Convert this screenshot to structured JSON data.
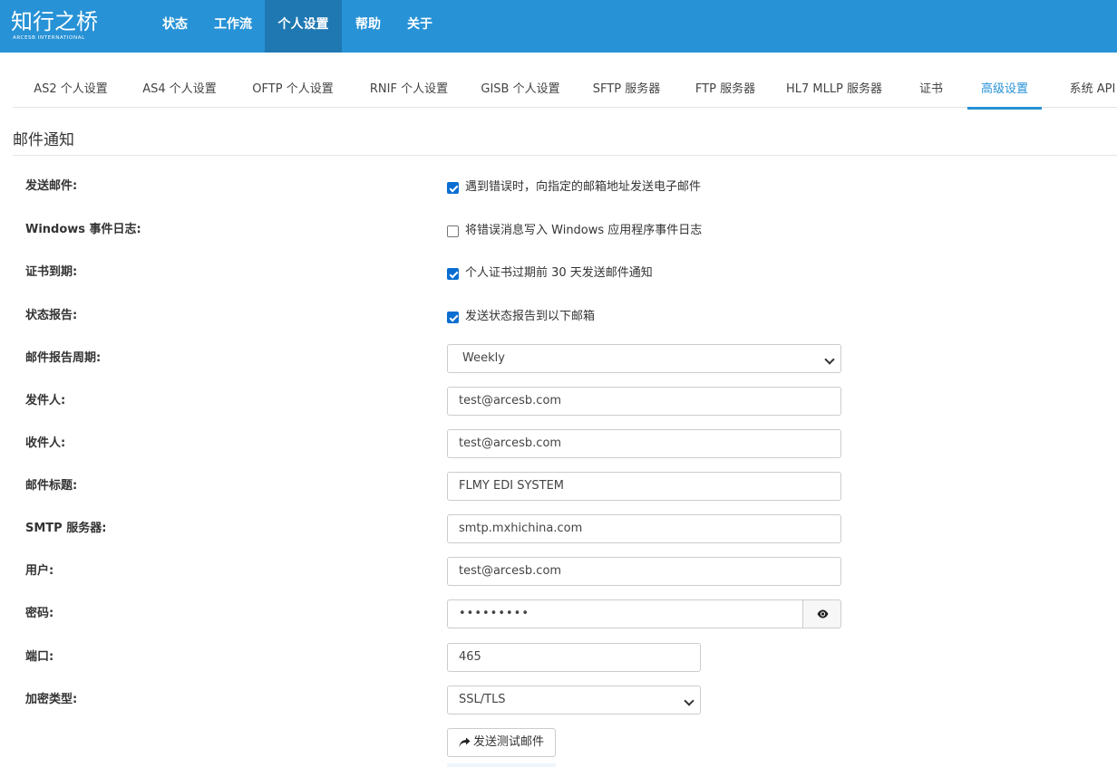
{
  "brand": {
    "name": "知行之桥",
    "tagline": "ARCESB INTERNATIONAL"
  },
  "colors": {
    "navbar": "#2792d6",
    "navbar_active": "#1f78b2",
    "accent": "#2792d6",
    "checkbox": "#0a6ed1"
  },
  "nav": {
    "items": [
      {
        "label": "状态",
        "active": false
      },
      {
        "label": "工作流",
        "active": false
      },
      {
        "label": "个人设置",
        "active": true
      },
      {
        "label": "帮助",
        "active": false
      },
      {
        "label": "关于",
        "active": false
      }
    ]
  },
  "subtabs": {
    "items": [
      {
        "label": "AS2 个人设置",
        "active": false
      },
      {
        "label": "AS4 个人设置",
        "active": false
      },
      {
        "label": "OFTP 个人设置",
        "active": false
      },
      {
        "label": "RNIF 个人设置",
        "active": false
      },
      {
        "label": "GISB 个人设置",
        "active": false
      },
      {
        "label": "SFTP 服务器",
        "active": false
      },
      {
        "label": "FTP 服务器",
        "active": false
      },
      {
        "label": "HL7 MLLP 服务器",
        "active": false
      },
      {
        "label": "证书",
        "active": false
      },
      {
        "label": "高级设置",
        "active": true
      },
      {
        "label": "系统 API",
        "active": false
      }
    ]
  },
  "section": {
    "title": "邮件通知"
  },
  "form": {
    "send_email": {
      "label": "发送邮件:",
      "checked": true,
      "text": "遇到错误时，向指定的邮箱地址发送电子邮件"
    },
    "windows_log": {
      "label": "Windows 事件日志:",
      "checked": false,
      "text": "将错误消息写入 Windows 应用程序事件日志"
    },
    "cert_expiry": {
      "label": "证书到期:",
      "checked": true,
      "text": "个人证书过期前 30 天发送邮件通知"
    },
    "status_report": {
      "label": "状态报告:",
      "checked": true,
      "text": "发送状态报告到以下邮箱"
    },
    "report_period": {
      "label": "邮件报告周期:",
      "value": "Weekly"
    },
    "sender": {
      "label": "发件人:",
      "value": "test@arcesb.com"
    },
    "recipient": {
      "label": "收件人:",
      "value": "test@arcesb.com"
    },
    "subject": {
      "label": "邮件标题:",
      "value": "FLMY EDI SYSTEM"
    },
    "smtp_server": {
      "label": "SMTP 服务器:",
      "value": "smtp.mxhichina.com"
    },
    "user": {
      "label": "用户:",
      "value": "test@arcesb.com"
    },
    "password": {
      "label": "密码:",
      "value": "•••••••••"
    },
    "port": {
      "label": "端口:",
      "value": "465"
    },
    "encryption": {
      "label": "加密类型:",
      "value": "SSL/TLS"
    },
    "test_button": {
      "label": "发送测试邮件"
    }
  }
}
